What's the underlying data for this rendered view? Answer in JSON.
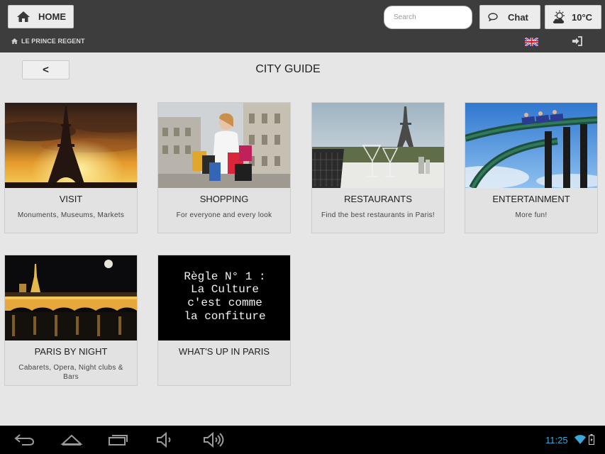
{
  "header": {
    "home_label": "HOME",
    "search_placeholder": "Search",
    "chat_label": "Chat",
    "temperature": "10°C",
    "breadcrumb": "LE PRINCE REGENT"
  },
  "page": {
    "back_label": "<",
    "title": "CITY GUIDE"
  },
  "cards": [
    {
      "title": "VISIT",
      "subtitle": "Monuments, Museums, Markets"
    },
    {
      "title": "SHOPPING",
      "subtitle": "For everyone and every look"
    },
    {
      "title": "RESTAURANTS",
      "subtitle": "Find the best restaurants in Paris!"
    },
    {
      "title": "ENTERTAINMENT",
      "subtitle": "More fun!"
    },
    {
      "title": "PARIS BY NIGHT",
      "subtitle": "Cabarets, Opera, Night clubs & Bars"
    },
    {
      "title": "WHAT'S UP IN PARIS",
      "subtitle": ""
    }
  ],
  "poster": {
    "lines": [
      "Règle N° 1 :",
      "La Culture",
      "c'est comme",
      "la confiture"
    ]
  },
  "statusbar": {
    "time": "11:25"
  },
  "icons": {
    "home": "home-icon",
    "chat": "chat-icon",
    "weather": "partly-cloudy-icon",
    "breadcrumb": "home-small-icon",
    "language": "uk-flag-icon",
    "login": "sign-in-icon",
    "nav": [
      "back-nav-icon",
      "home-nav-icon",
      "recent-apps-icon",
      "volume-down-icon",
      "volume-up-icon"
    ],
    "status": [
      "wifi-icon",
      "battery-icon"
    ]
  },
  "colors": {
    "topbar": "#3d3d3d",
    "background": "#e6e6e6",
    "clock": "#39a9d9"
  }
}
